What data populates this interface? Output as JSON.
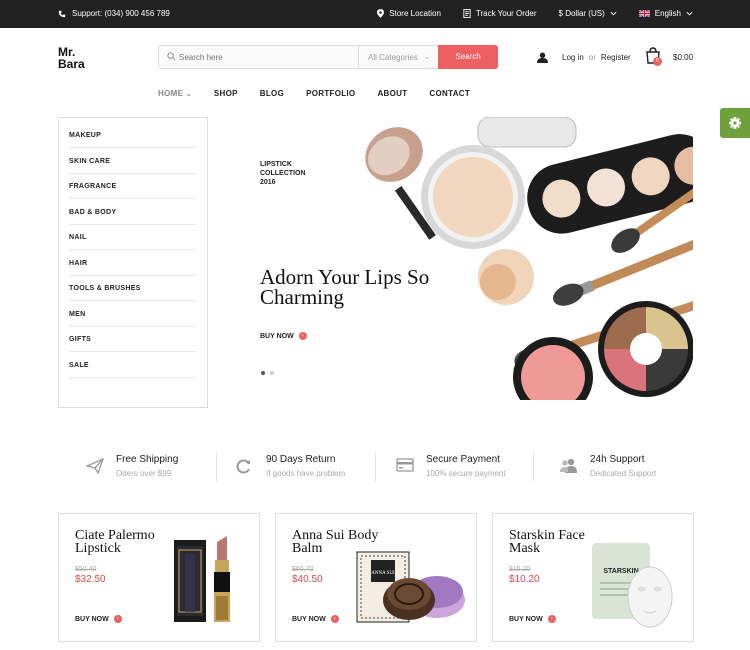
{
  "topbar": {
    "support": "Support: (034) 900 456 789",
    "store_location": "Store Location",
    "track_order": "Track Your Order",
    "currency": "$ Dollar (US)",
    "language": "English"
  },
  "logo": {
    "line1": "Mr.",
    "line2": "Bara"
  },
  "search": {
    "placeholder": "Search here",
    "category": "All Categories",
    "button": "Search"
  },
  "account": {
    "login": "Log in",
    "or": "or",
    "register": "Register"
  },
  "cart": {
    "count": "0",
    "total": "$0.00"
  },
  "nav": [
    "HOME",
    "SHOP",
    "BLOG",
    "PORTFOLIO",
    "ABOUT",
    "CONTACT"
  ],
  "sidebar": [
    "MAKEUP",
    "SKIN CARE",
    "FRAGRANCE",
    "BAD & BODY",
    "NAIL",
    "HAIR",
    "TOOLS & BRUSHES",
    "MEN",
    "GIFTS",
    "SALE"
  ],
  "hero": {
    "tag_line1": "LIPSTICK",
    "tag_line2": "COLLECTION",
    "tag_line3": "2016",
    "title_line1": "Adorn Your Lips So",
    "title_line2": "Charming",
    "cta": "BUY NOW"
  },
  "features": [
    {
      "title": "Free Shipping",
      "sub": "Oders over $99",
      "icon": "paper-plane-icon"
    },
    {
      "title": "90 Days Return",
      "sub": "If goods have problem",
      "icon": "refresh-icon"
    },
    {
      "title": "Secure Payment",
      "sub": "100% secure payment",
      "icon": "credit-card-icon"
    },
    {
      "title": "24h Support",
      "sub": "Dedicated Support",
      "icon": "users-icon"
    }
  ],
  "products": [
    {
      "title_line1": "Ciate Palermo",
      "title_line2": "Lipstick",
      "old_price": "$50.40",
      "price": "$32.50",
      "cta": "BUY NOW"
    },
    {
      "title_line1": "Anna Sui Body",
      "title_line2": "Balm",
      "old_price": "$60.70",
      "price": "$40.50",
      "cta": "BUY NOW",
      "box_label": "ANNA SUI"
    },
    {
      "title_line1": "Starskin Face",
      "title_line2": "Mask",
      "old_price": "$15.20",
      "price": "$10.20",
      "cta": "BUY NOW",
      "pack_label": "STARSKIN"
    }
  ],
  "colors": {
    "accent": "#ee5f62",
    "topbar": "#222222",
    "price": "#e1474b",
    "settings": "#6ea13b"
  }
}
